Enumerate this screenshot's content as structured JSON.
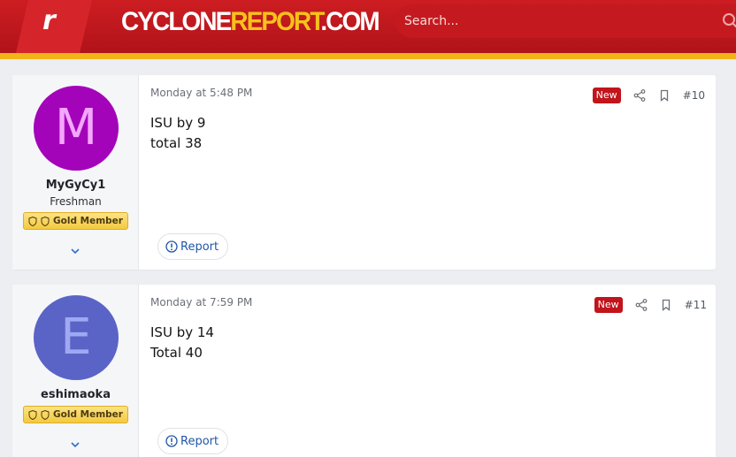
{
  "header": {
    "logo_letter": "r",
    "brand_part1": "CYCLONE",
    "brand_part2": "REPORT",
    "brand_part3": ".COM",
    "search_placeholder": "Search...",
    "colors": {
      "header_red": "#c41a1f",
      "stripe_gold": "#f2b417",
      "brand_gold": "#f7c21b"
    }
  },
  "posts": [
    {
      "avatar_letter": "M",
      "avatar_bg": "#a404b9",
      "avatar_fg": "#f3a7ff",
      "username": "MyGyCy1",
      "user_title": "Freshman",
      "banner": "Gold Member",
      "date": "Monday at 5:48 PM",
      "new_badge": "New",
      "post_number": "#10",
      "lines": [
        "ISU by 9",
        "total 38"
      ],
      "report_label": "Report"
    },
    {
      "avatar_letter": "E",
      "avatar_bg": "#5a64c6",
      "avatar_fg": "#9fa8f2",
      "username": "eshimaoka",
      "user_title": "",
      "banner": "Gold Member",
      "date": "Monday at 7:59 PM",
      "new_badge": "New",
      "post_number": "#11",
      "lines": [
        "ISU by 14",
        "Total 40"
      ],
      "report_label": "Report"
    }
  ],
  "icons": [
    "share-icon",
    "bookmark-icon",
    "search-icon",
    "report-icon",
    "chevron-down-icon",
    "shield-icon"
  ]
}
